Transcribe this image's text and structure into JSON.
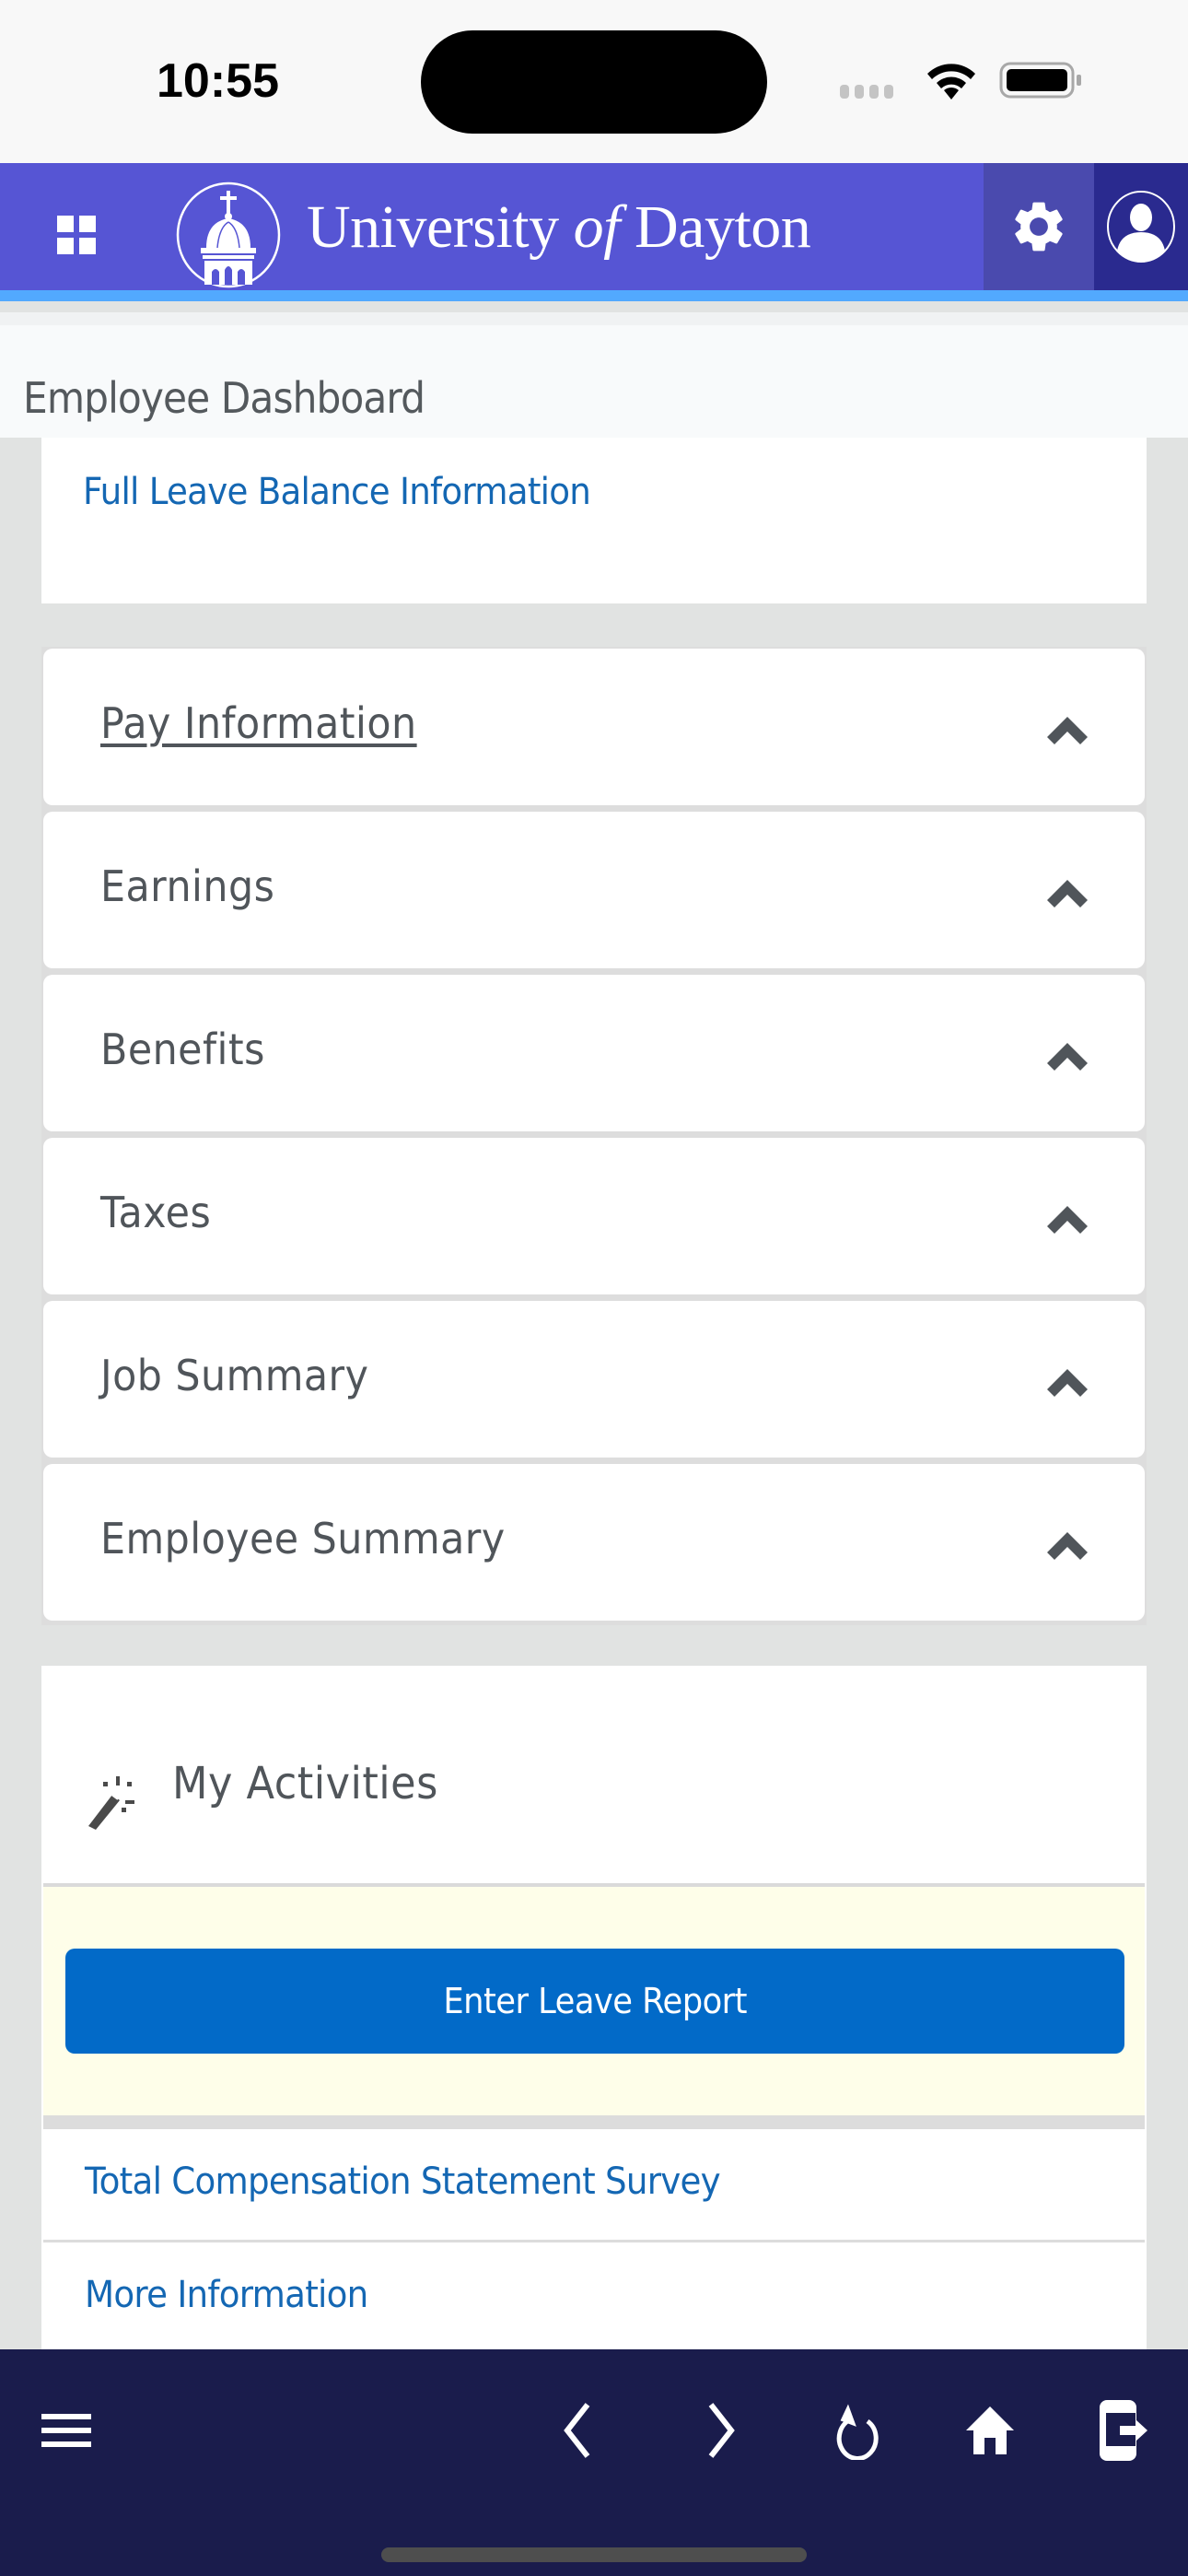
{
  "status_bar": {
    "time": "10:55"
  },
  "header": {
    "logo_text_main": "University ",
    "logo_text_of": "of",
    "logo_text_end": " Dayton",
    "brand_color": "#5655d4",
    "accent_color": "#52a9fe"
  },
  "page": {
    "title": "Employee Dashboard"
  },
  "leave_card": {
    "link": "Full Leave Balance Information"
  },
  "accordion": {
    "items": [
      {
        "label": "Pay Information",
        "state": "collapsed"
      },
      {
        "label": "Earnings",
        "state": "collapsed"
      },
      {
        "label": "Benefits",
        "state": "collapsed"
      },
      {
        "label": "Taxes",
        "state": "collapsed"
      },
      {
        "label": "Job Summary",
        "state": "collapsed"
      },
      {
        "label": "Employee Summary",
        "state": "collapsed"
      }
    ]
  },
  "activities": {
    "title": "My Activities",
    "icon": "magic-wand-icon",
    "primary_button": "Enter Leave Report",
    "links": [
      "Total Compensation Statement Survey",
      "More Information"
    ]
  },
  "toolbar": {
    "icons": [
      "menu-icon",
      "back-icon",
      "forward-icon",
      "reload-icon",
      "home-icon",
      "exit-icon"
    ]
  }
}
